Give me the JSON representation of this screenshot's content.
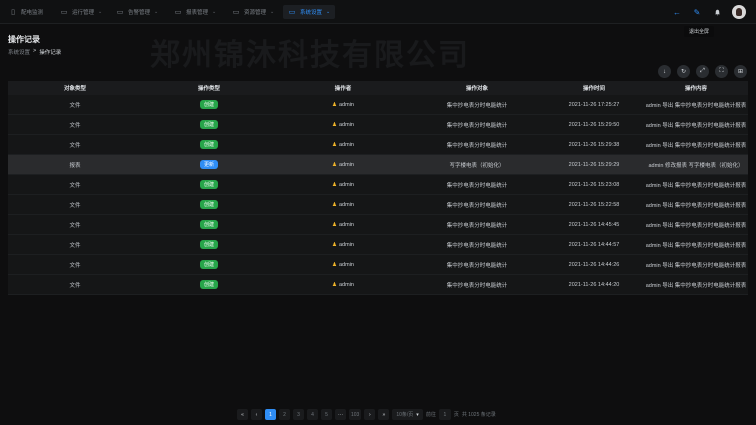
{
  "tabs": [
    {
      "label": "配电监测",
      "icon": "document-icon",
      "active": false
    },
    {
      "label": "运行管理",
      "icon": "folder-icon",
      "active": false
    },
    {
      "label": "告警管理",
      "icon": "folder-icon",
      "active": false
    },
    {
      "label": "报表管理",
      "icon": "folder-icon",
      "active": false
    },
    {
      "label": "资源管理",
      "icon": "folder-icon",
      "active": false
    },
    {
      "label": "系统设置",
      "icon": "folder-icon",
      "active": true
    }
  ],
  "header_icons": {
    "back": "←",
    "edit": "✎",
    "bell": "🔔"
  },
  "tooltip": "退出全屏",
  "watermark": "郑州锦沐科技有限公司",
  "page_title": "操作记录",
  "breadcrumb": {
    "parent": "系统设置",
    "separator": ">",
    "current": "操作记录"
  },
  "tools": [
    "↓",
    "↻",
    "⤢",
    "⛶",
    "⊞"
  ],
  "table": {
    "columns": [
      "对象类型",
      "操作类型",
      "操作者",
      "操作对象",
      "操作时间",
      "操作内容"
    ],
    "rows": [
      {
        "obj_type": "文件",
        "op_type": "创建",
        "badge": "green",
        "operator": "admin",
        "target": "集中抄电表分时电能统计",
        "time": "2021-11-26 17:25:27",
        "content": "admin 导出 集中抄电表分时电能统计报表"
      },
      {
        "obj_type": "文件",
        "op_type": "创建",
        "badge": "green",
        "operator": "admin",
        "target": "集中抄电表分时电能统计",
        "time": "2021-11-26 15:29:50",
        "content": "admin 导出 集中抄电表分时电能统计报表"
      },
      {
        "obj_type": "文件",
        "op_type": "创建",
        "badge": "green",
        "operator": "admin",
        "target": "集中抄电表分时电能统计",
        "time": "2021-11-26 15:29:38",
        "content": "admin 导出 集中抄电表分时电能统计报表"
      },
      {
        "obj_type": "报表",
        "op_type": "更新",
        "badge": "blue",
        "operator": "admin",
        "target": "写字楼电表（初始化）",
        "time": "2021-11-26 15:29:29",
        "content": "admin 修改报表 写字楼电表（初始化）"
      },
      {
        "obj_type": "文件",
        "op_type": "创建",
        "badge": "green",
        "operator": "admin",
        "target": "集中抄电表分时电能统计",
        "time": "2021-11-26 15:23:08",
        "content": "admin 导出 集中抄电表分时电能统计报表"
      },
      {
        "obj_type": "文件",
        "op_type": "创建",
        "badge": "green",
        "operator": "admin",
        "target": "集中抄电表分时电能统计",
        "time": "2021-11-26 15:22:58",
        "content": "admin 导出 集中抄电表分时电能统计报表"
      },
      {
        "obj_type": "文件",
        "op_type": "创建",
        "badge": "green",
        "operator": "admin",
        "target": "集中抄电表分时电能统计",
        "time": "2021-11-26 14:45:45",
        "content": "admin 导出 集中抄电表分时电能统计报表"
      },
      {
        "obj_type": "文件",
        "op_type": "创建",
        "badge": "green",
        "operator": "admin",
        "target": "集中抄电表分时电能统计",
        "time": "2021-11-26 14:44:57",
        "content": "admin 导出 集中抄电表分时电能统计报表"
      },
      {
        "obj_type": "文件",
        "op_type": "创建",
        "badge": "green",
        "operator": "admin",
        "target": "集中抄电表分时电能统计",
        "time": "2021-11-26 14:44:26",
        "content": "admin 导出 集中抄电表分时电能统计报表"
      },
      {
        "obj_type": "文件",
        "op_type": "创建",
        "badge": "green",
        "operator": "admin",
        "target": "集中抄电表分时电能统计",
        "time": "2021-11-26 14:44:20",
        "content": "admin 导出 集中抄电表分时电能统计报表"
      }
    ]
  },
  "pagination": {
    "first": "«",
    "prev": "‹",
    "next": "›",
    "last": "»",
    "pages": [
      "1",
      "2",
      "3",
      "4",
      "5",
      "···",
      "103"
    ],
    "active_page": "1",
    "page_size": "10条/页",
    "goto_label": "前往",
    "goto_value": "1",
    "page_suffix": "页",
    "total": "共 1025 条记录"
  },
  "colors": {
    "accent": "#2f8df4",
    "success": "#27a54a",
    "user": "#f0b429"
  }
}
